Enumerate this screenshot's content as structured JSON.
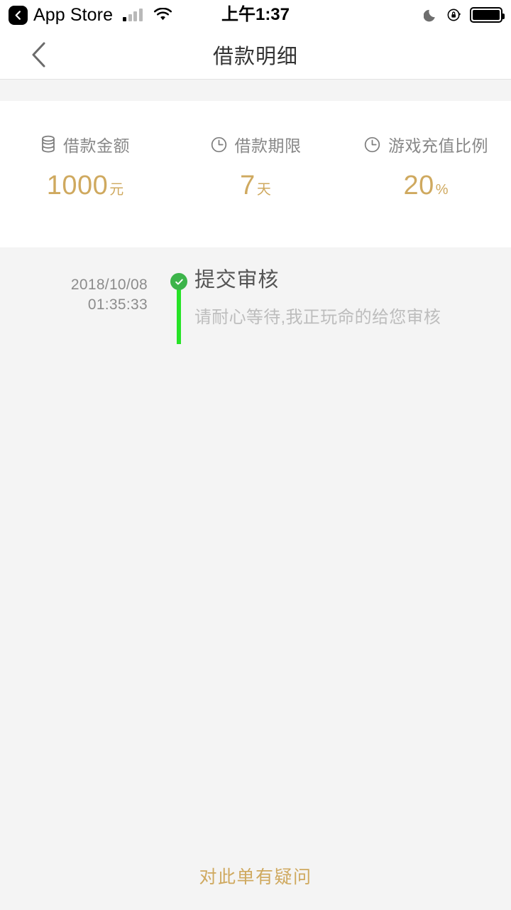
{
  "status_bar": {
    "back_app_label": "App Store",
    "back_icon": "chevron-left-icon",
    "signal_icon": "cellular-signal-icon",
    "wifi_icon": "wifi-icon",
    "time": "上午1:37",
    "dnd_icon": "moon-icon",
    "rotation_lock_icon": "rotation-lock-icon",
    "battery_icon": "battery-full-icon"
  },
  "nav": {
    "back_icon": "chevron-left-icon",
    "title": "借款明细"
  },
  "summary": {
    "items": [
      {
        "icon": "coin-stack-icon",
        "label": "借款金额",
        "value": "1000",
        "unit": "元"
      },
      {
        "icon": "clock-icon",
        "label": "借款期限",
        "value": "7",
        "unit": "天"
      },
      {
        "icon": "clock-icon",
        "label": "游戏充值比例",
        "value": "20",
        "unit": "%"
      }
    ]
  },
  "timeline": {
    "entries": [
      {
        "date": "2018/10/08",
        "time": "01:35:33",
        "status_icon": "check-circle-icon",
        "title": "提交审核",
        "description": "请耐心等待,我正玩命的给您审核"
      }
    ]
  },
  "footer": {
    "link_label": "对此单有疑问"
  },
  "colors": {
    "accent_gold": "#cfa95f",
    "status_green": "#3cb44a",
    "line_green": "#27e327",
    "page_background": "#f4f4f4",
    "card_background": "#ffffff",
    "title_gray": "#333333",
    "label_gray": "#888888",
    "muted_gray": "#bdbdbd"
  }
}
